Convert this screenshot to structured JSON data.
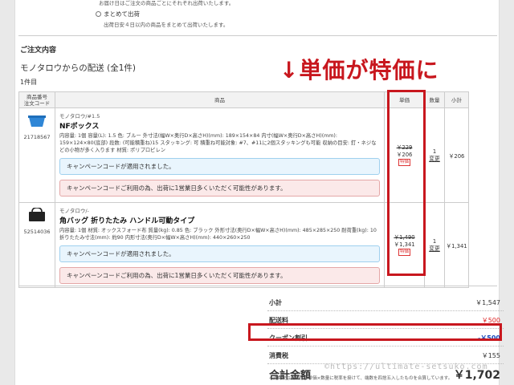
{
  "shipping_options": {
    "top_desc": "お届け日はご注文の商品ごとにそれぞれ出荷いたします。",
    "combined_label": "まとめて出荷",
    "combined_desc": "出荷日安４日以内の商品をまとめて出荷いたします。"
  },
  "order": {
    "section_title": "ご注文内容",
    "ship_heading": "モノタロウからの配送 (全1件)",
    "item_no": "1件目",
    "headers": {
      "code": "商品番号\n注文コード",
      "name": "商品",
      "price": "単価",
      "qty": "数量",
      "subtotal": "小計"
    },
    "items": [
      {
        "code": "21718567",
        "brand": "モノタロウ/#1.5",
        "name": "NFボックス",
        "desc": "内容量: 1個 容量(L): 1.5 色: ブルー 外寸法(幅W×奥行D×高さH)(mm): 189×154×84 内寸(幅W×奥行D×高さH)(mm): 159×124×80(底部) 段数: (可能積重ね)15 スタッキング: 可 積重ね可能対象: #7、#11に2個スタッキングも可能 収納の目安: 釘・ネジなどの小物が多く入ります 材質: ポリプロピレン",
        "campaign_applied": "キャンペーンコードが適用されました。",
        "campaign_note": "キャンペーンコードご利用の為、出荷に1営業日多くいただく可能性があります。",
        "price_old": "￥229",
        "price_new": "￥206",
        "badge": "特価",
        "qty": "1",
        "change": "変更",
        "subtotal": "￥206"
      },
      {
        "code": "52514036",
        "brand": "モノタロウ/-",
        "name": "角バッグ 折りたたみ ハンドル可動タイプ",
        "desc": "内容量: 1個 材質: オックスフォード布 質量(kg): 0.85 色: ブラック 外形寸法(奥行D×幅W×高さH)(mm): 485×285×250 耐荷重(kg): 10 折りたたみ寸法(mm): 約90 内形寸法(奥行D×幅W×高さH)(mm): 440×260×250",
        "campaign_applied": "キャンペーンコードが適用されました。",
        "campaign_note": "キャンペーンコードご利用の為、出荷に1営業日多くいただく可能性があります。",
        "price_old": "￥1,490",
        "price_new": "￥1,341",
        "badge": "特価",
        "qty": "1",
        "change": "変更",
        "subtotal": "￥1,341"
      }
    ]
  },
  "annotation": "↓単価が特価に",
  "summary": {
    "subtotal_label": "小計",
    "subtotal_value": "￥1,547",
    "shipping_label": "配送料",
    "shipping_value": "￥500",
    "coupon_label": "クーポン割引",
    "coupon_value": "-￥500",
    "tax_label": "消費税",
    "tax_value": "￥155",
    "total_label": "合計金額",
    "total_value": "￥1,702",
    "note": "※消費税は明細行の単価×数量に税率を掛けて、端数を四捨五入したものを合算しています。"
  },
  "watermark": "©https://ultimate-setsuko.com",
  "colors": {
    "highlight_red": "#c8171e",
    "discount_blue": "#1442b8",
    "shipping_red": "#d22222"
  },
  "icons": {
    "radio": "radio-unchecked"
  }
}
